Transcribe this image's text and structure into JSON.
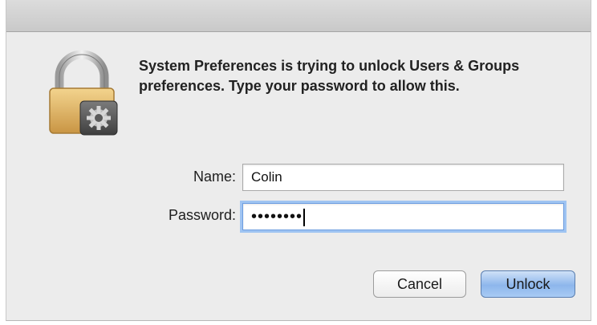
{
  "dialog": {
    "message": "System Preferences is trying to unlock Users & Groups preferences. Type your password to allow this.",
    "icon": "lock-icon",
    "fields": {
      "name_label": "Name:",
      "name_value": "Colin",
      "password_label": "Password:",
      "password_masked": "••••••••"
    },
    "buttons": {
      "cancel_label": "Cancel",
      "unlock_label": "Unlock"
    },
    "colors": {
      "focus_ring": "#9fc4f2",
      "default_button": "#8db6ec"
    }
  }
}
